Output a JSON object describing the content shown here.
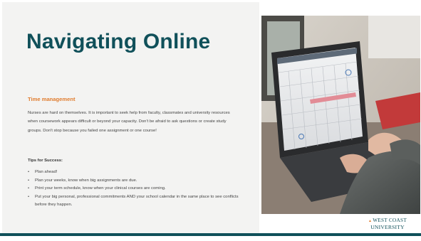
{
  "slide": {
    "title": "Navigating Online",
    "section_heading": "Time management",
    "intro_text": "Nurses are hard on themselves. It is important to seek help from faculty, classmates and university resources when coursework appears difficult or beyond your capacity. Don't be afraid to ask questions or create study groups. Don't stop because you failed one assignment or one course!",
    "tips_heading": "Tips for Success:",
    "tips": [
      "Plan ahead!",
      "Plan your weeks, know when big assignments are due.",
      "Print your term schedule, know when your clinical courses are coming.",
      "Put your big personal, professional commitments AND your school calendar in the same place to see conflicts before they happen."
    ]
  },
  "logo": {
    "line1": "WEST COAST",
    "line2": "UNIVERSITY"
  },
  "photo": {
    "icon": "laptop-calendar-photo"
  },
  "colors": {
    "title": "#10505a",
    "heading_accent": "#e07c2e",
    "bottom_bar": "#10505a",
    "panel_background": "#f3f3f2"
  }
}
